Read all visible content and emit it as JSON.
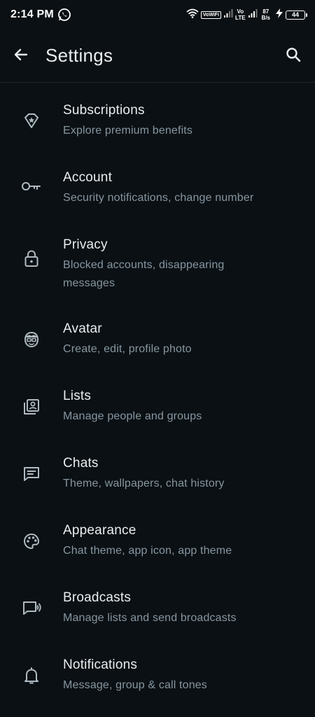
{
  "status_bar": {
    "time": "2:14 PM",
    "vowifi": "VoWiFi",
    "volte_top": "Vo",
    "volte_bottom": "LTE",
    "speed_value": "87",
    "speed_unit": "B/s",
    "battery": "44"
  },
  "header": {
    "title": "Settings"
  },
  "settings": [
    {
      "icon": "badge-star-icon",
      "title": "Subscriptions",
      "subtitle": "Explore premium benefits"
    },
    {
      "icon": "key-icon",
      "title": "Account",
      "subtitle": "Security notifications, change number"
    },
    {
      "icon": "lock-icon",
      "title": "Privacy",
      "subtitle_line1": "Blocked accounts, disappearing",
      "subtitle_line2": "messages"
    },
    {
      "icon": "avatar-face-icon",
      "title": "Avatar",
      "subtitle": "Create, edit, profile photo"
    },
    {
      "icon": "contact-list-icon",
      "title": "Lists",
      "subtitle": "Manage people and groups"
    },
    {
      "icon": "chat-message-icon",
      "title": "Chats",
      "subtitle": "Theme, wallpapers, chat history"
    },
    {
      "icon": "palette-icon",
      "title": "Appearance",
      "subtitle": "Chat theme, app icon, app theme"
    },
    {
      "icon": "broadcast-icon",
      "title": "Broadcasts",
      "subtitle": "Manage lists and send broadcasts"
    },
    {
      "icon": "bell-icon",
      "title": "Notifications",
      "subtitle": "Message, group & call tones"
    }
  ],
  "colors": {
    "background": "#0b1014",
    "primary_text": "#e9edef",
    "secondary_text": "#8696a0",
    "icon": "#aebac1"
  }
}
